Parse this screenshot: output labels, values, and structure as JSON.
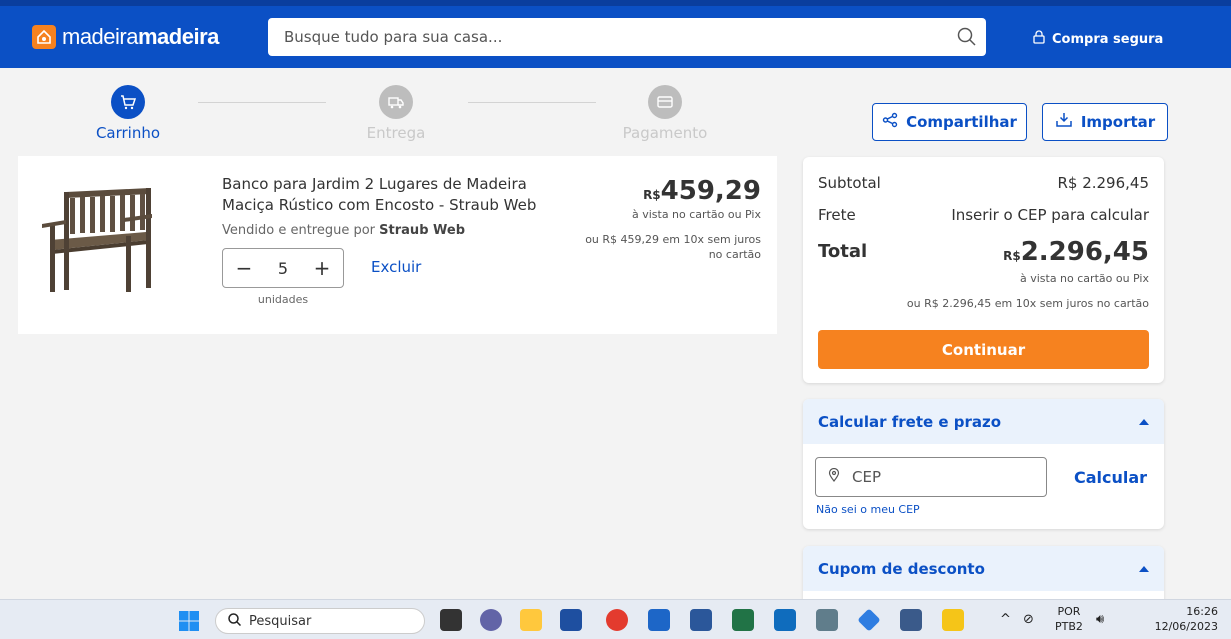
{
  "header": {
    "logo_light": "madeira",
    "logo_bold": "madeira",
    "search_placeholder": "Busque tudo para sua casa...",
    "secure_label": "Compra segura"
  },
  "steps": [
    {
      "label": "Carrinho",
      "active": true
    },
    {
      "label": "Entrega",
      "active": false
    },
    {
      "label": "Pagamento",
      "active": false
    }
  ],
  "actions": {
    "share_label": "Compartilhar",
    "import_label": "Importar"
  },
  "cart_item": {
    "title": "Banco para Jardim 2 Lugares de Madeira Maciça Rústico com Encosto - Straub Web",
    "seller_prefix": "Vendido e entregue por",
    "seller_name": "Straub Web",
    "quantity": "5",
    "qty_minus": "−",
    "qty_plus": "+",
    "units_label": "unidades",
    "remove_label": "Excluir",
    "currency": "R$",
    "price": "459,29",
    "price_note": "à vista no cartão ou Pix",
    "installments": "ou R$ 459,29 em 10x sem juros no cartão"
  },
  "summary": {
    "subtotal_label": "Subtotal",
    "subtotal_value": "R$ 2.296,45",
    "shipping_label": "Frete",
    "shipping_value": "Inserir o CEP para calcular",
    "total_label": "Total",
    "total_currency": "R$",
    "total_value": "2.296,45",
    "total_note": "à vista no cartão ou Pix",
    "total_installments": "ou R$ 2.296,45 em 10x sem juros no cartão",
    "continue_label": "Continuar"
  },
  "shipping_calc": {
    "title": "Calcular frete e prazo",
    "cep_placeholder": "CEP",
    "calc_label": "Calcular",
    "dont_know_label": "Não sei o meu CEP"
  },
  "coupon": {
    "title": "Cupom de desconto"
  },
  "taskbar": {
    "search_label": "Pesquisar",
    "lang_top": "POR",
    "lang_bottom": "PTB2",
    "time": "16:26",
    "date": "12/06/2023"
  },
  "colors": {
    "brand_blue": "#0b50c5",
    "accent_orange": "#f6821f"
  }
}
